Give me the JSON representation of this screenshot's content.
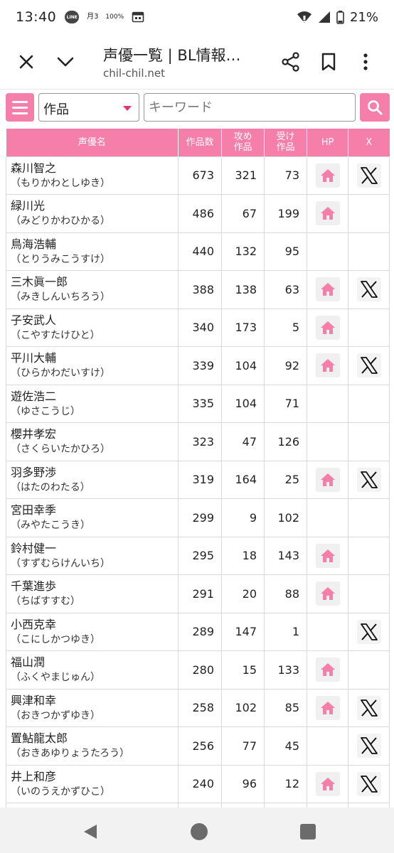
{
  "status_bar": {
    "time": "13:40",
    "line_label": "LINE",
    "calendar_month": "月",
    "calendar_day": "3",
    "weather_percent": "100%",
    "battery": "21%"
  },
  "browser": {
    "title": "声優一覧 | BL情報…",
    "url": "chil-chil.net"
  },
  "search": {
    "category": "作品",
    "keyword_placeholder": "キーワード"
  },
  "table": {
    "headers": [
      "声優名",
      "作品数",
      "攻め\n作品",
      "受け\n作品",
      "HP",
      "X"
    ],
    "rows": [
      {
        "name": "森川智之",
        "reading": "（もりかわとしゆき）",
        "works": "673",
        "seme": "321",
        "uke": "73",
        "hp": true,
        "x": true
      },
      {
        "name": "緑川光",
        "reading": "（みどりかわひかる）",
        "works": "486",
        "seme": "67",
        "uke": "199",
        "hp": true,
        "x": false
      },
      {
        "name": "鳥海浩輔",
        "reading": "（とりうみこうすけ）",
        "works": "440",
        "seme": "132",
        "uke": "95",
        "hp": false,
        "x": false
      },
      {
        "name": "三木眞一郎",
        "reading": "（みきしんいちろう）",
        "works": "388",
        "seme": "138",
        "uke": "63",
        "hp": true,
        "x": true
      },
      {
        "name": "子安武人",
        "reading": "（こやすたけひと）",
        "works": "340",
        "seme": "173",
        "uke": "5",
        "hp": true,
        "x": false
      },
      {
        "name": "平川大輔",
        "reading": "（ひらかわだいすけ）",
        "works": "339",
        "seme": "104",
        "uke": "92",
        "hp": true,
        "x": true
      },
      {
        "name": "遊佐浩二",
        "reading": "（ゆさこうじ）",
        "works": "335",
        "seme": "104",
        "uke": "71",
        "hp": false,
        "x": false
      },
      {
        "name": "櫻井孝宏",
        "reading": "（さくらいたかひろ）",
        "works": "323",
        "seme": "47",
        "uke": "126",
        "hp": false,
        "x": false
      },
      {
        "name": "羽多野渉",
        "reading": "（はたのわたる）",
        "works": "319",
        "seme": "164",
        "uke": "25",
        "hp": true,
        "x": true
      },
      {
        "name": "宮田幸季",
        "reading": "（みやたこうき）",
        "works": "299",
        "seme": "9",
        "uke": "102",
        "hp": false,
        "x": false
      },
      {
        "name": "鈴村健一",
        "reading": "（すずむらけんいち）",
        "works": "295",
        "seme": "18",
        "uke": "143",
        "hp": true,
        "x": false
      },
      {
        "name": "千葉進歩",
        "reading": "（ちばすすむ）",
        "works": "291",
        "seme": "20",
        "uke": "88",
        "hp": true,
        "x": false
      },
      {
        "name": "小西克幸",
        "reading": "（こにしかつゆき）",
        "works": "289",
        "seme": "147",
        "uke": "1",
        "hp": false,
        "x": true
      },
      {
        "name": "福山潤",
        "reading": "（ふくやまじゅん）",
        "works": "280",
        "seme": "15",
        "uke": "133",
        "hp": true,
        "x": false
      },
      {
        "name": "興津和幸",
        "reading": "（おきつかずゆき）",
        "works": "258",
        "seme": "102",
        "uke": "85",
        "hp": true,
        "x": true
      },
      {
        "name": "置鮎龍太郎",
        "reading": "（おきあゆりょうたろう）",
        "works": "256",
        "seme": "77",
        "uke": "45",
        "hp": false,
        "x": true
      },
      {
        "name": "井上和彦",
        "reading": "（いのうえかずひこ）",
        "works": "240",
        "seme": "96",
        "uke": "12",
        "hp": true,
        "x": true
      },
      {
        "name": "",
        "reading": "",
        "works": "",
        "seme": "",
        "uke": "",
        "hp": false,
        "x": false
      }
    ]
  },
  "colors": {
    "accent": "#f57fa8",
    "caret": "#e5336f"
  }
}
